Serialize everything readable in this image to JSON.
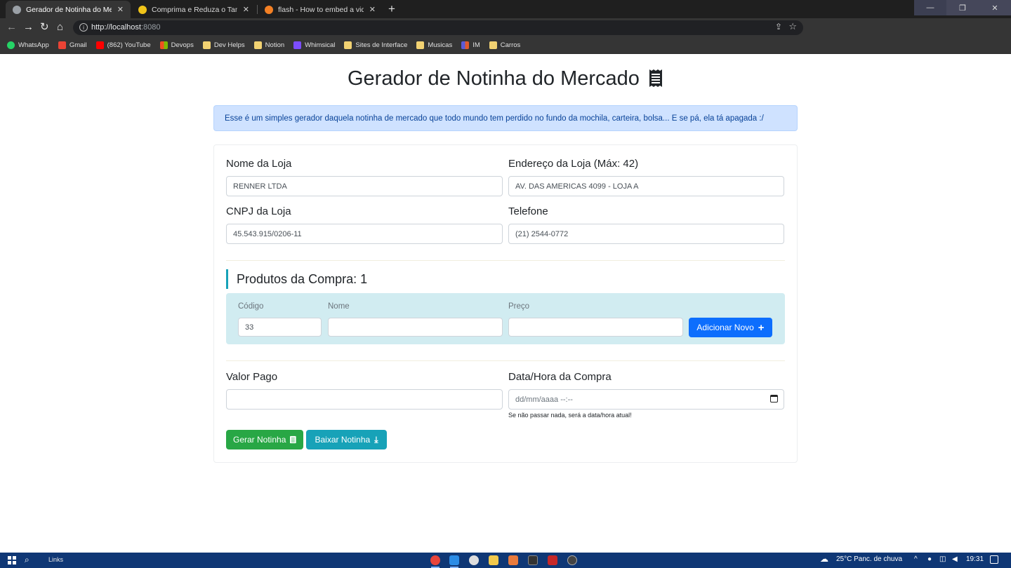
{
  "browser": {
    "tabs": [
      {
        "title": "Gerador de Notinha do Mercado",
        "close": "✕",
        "active": true,
        "favicon_color": "#9aa0a6"
      },
      {
        "title": "Comprima e Reduza o Tamanho",
        "close": "✕",
        "active": false,
        "favicon_color": "#f0c419"
      },
      {
        "title": "flash - How to embed a video in",
        "close": "✕",
        "active": false,
        "favicon_color": "#f48024"
      }
    ],
    "new_tab": "+",
    "url_host": "http://localhost",
    "url_port": ":8080",
    "window_controls": {
      "minimize": "—",
      "restore": "❐",
      "close": "✕"
    },
    "bookmarks": [
      {
        "label": "WhatsApp",
        "icon": "whatsapp-icon",
        "color": "#25d366"
      },
      {
        "label": "Gmail",
        "icon": "gmail-icon",
        "color": "#ea4335"
      },
      {
        "label": "(862) YouTube",
        "icon": "youtube-icon",
        "color": "#ff0000"
      },
      {
        "label": "Devops",
        "icon": "microsoft-icon",
        "color": "#f25022"
      },
      {
        "label": "Dev Helps",
        "icon": "folder-icon",
        "color": "#f2d272"
      },
      {
        "label": "Notion",
        "icon": "folder-icon",
        "color": "#f2d272"
      },
      {
        "label": "Whimsical",
        "icon": "whimsical-icon",
        "color": "#7c4dff"
      },
      {
        "label": "Sites de Interface",
        "icon": "folder-icon",
        "color": "#f2d272"
      },
      {
        "label": "Musicas",
        "icon": "folder-icon",
        "color": "#f2d272"
      },
      {
        "label": "IM",
        "icon": "im-icon",
        "color": "#e05a2b"
      },
      {
        "label": "Carros",
        "icon": "folder-icon",
        "color": "#f2d272"
      }
    ]
  },
  "page": {
    "title": "Gerador de Notinha do Mercado",
    "alert": "Esse é um simples gerador daquela notinha de mercado que todo mundo tem perdido no fundo da mochila, carteira, bolsa... E se pá, ela tá apagada :/",
    "form": {
      "store_name": {
        "label": "Nome da Loja",
        "value": "RENNER LTDA"
      },
      "store_address": {
        "label": "Endereço da Loja (Máx: 42)",
        "value": "AV. DAS AMERICAS 4099 - LOJA A"
      },
      "cnpj": {
        "label": "CNPJ da Loja",
        "value": "45.543.915/0206-11"
      },
      "phone": {
        "label": "Telefone",
        "value": "(21) 2544-0772"
      }
    },
    "products": {
      "title": "Produtos da Compra: 1",
      "code_label": "Código",
      "code_value": "33",
      "name_label": "Nome",
      "name_value": "",
      "price_label": "Preço",
      "price_value": "",
      "add_button": "Adicionar Novo",
      "add_icon": "+"
    },
    "payment": {
      "amount_label": "Valor Pago",
      "amount_value": "",
      "datetime_label": "Data/Hora da Compra",
      "datetime_placeholder": "dd/mm/aaaa  --:--",
      "hint": "Se não passar nada, será a data/hora atual!"
    },
    "actions": {
      "generate": "Gerar Notinha",
      "download": "Baixar Notinha",
      "download_icon": "⤓"
    }
  },
  "taskbar": {
    "links": "Links",
    "weather": "25°C  Panc. de chuva",
    "time": "19:31",
    "tray_icons": "^",
    "apps": [
      {
        "icon": "chrome-icon",
        "color": "#e8453c"
      },
      {
        "icon": "vscode-icon",
        "color": "#2b8ce6"
      },
      {
        "icon": "obs-icon",
        "color": "#dddddd"
      },
      {
        "icon": "explorer-icon",
        "color": "#f2c94c"
      },
      {
        "icon": "store-icon",
        "color": "#e87a3c"
      },
      {
        "icon": "terminal-icon",
        "color": "#333333"
      },
      {
        "icon": "filezilla-icon",
        "color": "#c62828"
      },
      {
        "icon": "github-icon",
        "color": "#444444"
      }
    ]
  }
}
